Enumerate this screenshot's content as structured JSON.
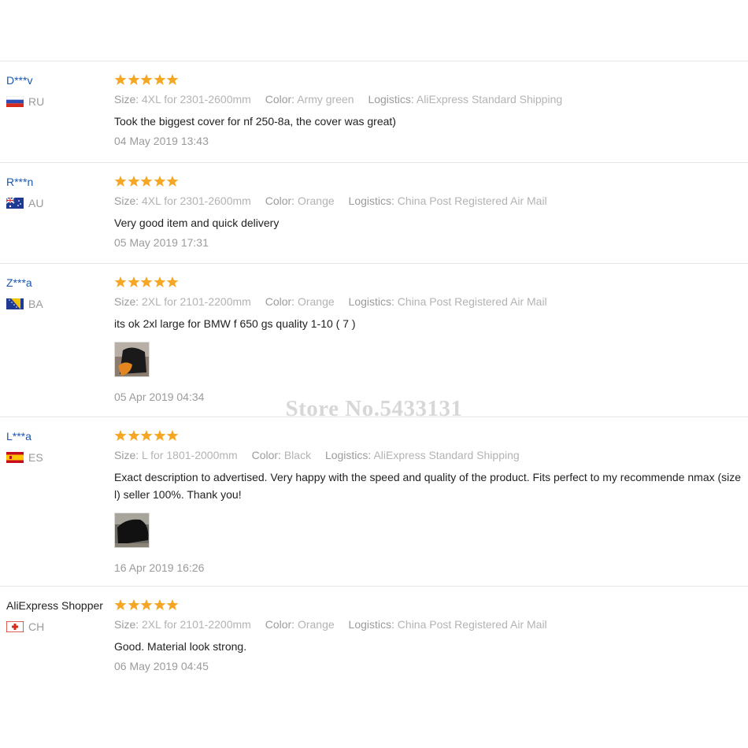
{
  "reviews": [
    {
      "user": "D***v",
      "country": "RU",
      "flag": "ru",
      "rating": 5,
      "size_label": "Size:",
      "size": "4XL for 2301-2600mm",
      "color_label": "Color:",
      "color": "Army green",
      "logistics_label": "Logistics:",
      "logistics": "AliExpress Standard Shipping",
      "text": "Took the biggest cover for nf 250-8a, the cover was great)",
      "date": "04 May 2019 13:43",
      "photo": ""
    },
    {
      "user": "R***n",
      "country": "AU",
      "flag": "au",
      "rating": 5,
      "size_label": "Size:",
      "size": "4XL for 2301-2600mm",
      "color_label": "Color:",
      "color": "Orange",
      "logistics_label": "Logistics:",
      "logistics": "China Post Registered Air Mail",
      "text": "Very good item and quick delivery",
      "date": "05 May 2019 17:31",
      "photo": ""
    },
    {
      "user": "Z***a",
      "country": "BA",
      "flag": "ba",
      "rating": 5,
      "size_label": "Size:",
      "size": "2XL for 2101-2200mm",
      "color_label": "Color:",
      "color": "Orange",
      "logistics_label": "Logistics:",
      "logistics": "China Post Registered Air Mail",
      "text": "its ok 2xl large for BMW f 650 gs quality 1-10 ( 7 )",
      "date": "05 Apr 2019 04:34",
      "photo": "orange-cover"
    },
    {
      "user": "L***a",
      "country": "ES",
      "flag": "es",
      "rating": 5,
      "size_label": "Size:",
      "size": "L for 1801-2000mm",
      "color_label": "Color:",
      "color": "Black",
      "logistics_label": "Logistics:",
      "logistics": "AliExpress Standard Shipping",
      "text": "Exact description to advertised. Very happy with the speed and quality of the product. Fits perfect to my recommende nmax (size l) seller 100%. Thank you!",
      "date": "16 Apr 2019 16:26",
      "photo": "black-cover"
    },
    {
      "user": "AliExpress Shopper",
      "country": "CH",
      "flag": "ch",
      "rating": 5,
      "size_label": "Size:",
      "size": "2XL for 2101-2200mm",
      "color_label": "Color:",
      "color": "Orange",
      "logistics_label": "Logistics:",
      "logistics": "China Post Registered Air Mail",
      "text": "Good. Material look strong.",
      "date": "06 May 2019 04:45",
      "photo": ""
    }
  ],
  "watermark": "Store No.5433131",
  "colors": {
    "username": "#1c57b0",
    "star": "#f5a623",
    "muted": "#9b9b9b",
    "divider": "#e6e6e6"
  }
}
